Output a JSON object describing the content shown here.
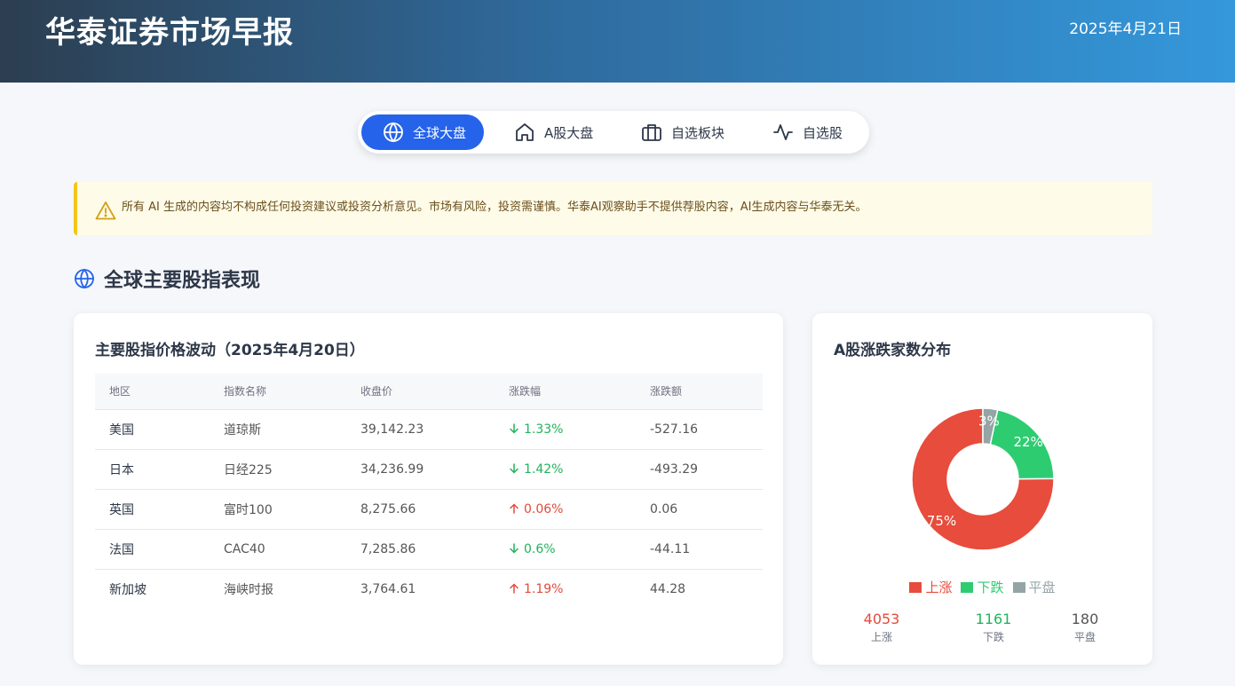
{
  "header": {
    "title": "华泰证券市场早报",
    "date": "2025年4月21日"
  },
  "tabs": [
    {
      "label": "全球大盘",
      "icon": "globe-icon",
      "active": true
    },
    {
      "label": "A股大盘",
      "icon": "home-icon",
      "active": false
    },
    {
      "label": "自选板块",
      "icon": "briefcase-icon",
      "active": false
    },
    {
      "label": "自选股",
      "icon": "activity-icon",
      "active": false
    }
  ],
  "notice": {
    "icon": "warning-icon",
    "text": "所有 AI 生成的内容均不构成任何投资建议或投资分析意见。市场有风险，投资需谨慎。华泰AI观察助手不提供荐股内容，AI生成内容与华泰无关。"
  },
  "section": {
    "title": "全球主要股指表现",
    "icon": "globe-icon"
  },
  "index_table": {
    "title": "主要股指价格波动（2025年4月20日）",
    "columns": [
      "地区",
      "指数名称",
      "收盘价",
      "涨跌幅",
      "涨跌额"
    ],
    "rows": [
      {
        "region": "美国",
        "name": "道琼斯",
        "close": "39,142.23",
        "pct": "1.33%",
        "dir": "down",
        "change": "-527.16"
      },
      {
        "region": "日本",
        "name": "日经225",
        "close": "34,236.99",
        "pct": "1.42%",
        "dir": "down",
        "change": "-493.29"
      },
      {
        "region": "英国",
        "name": "富时100",
        "close": "8,275.66",
        "pct": "0.06%",
        "dir": "up",
        "change": "0.06"
      },
      {
        "region": "法国",
        "name": "CAC40",
        "close": "7,285.86",
        "pct": "0.6%",
        "dir": "down",
        "change": "-44.11"
      },
      {
        "region": "新加坡",
        "name": "海峡时报",
        "close": "3,764.61",
        "pct": "1.19%",
        "dir": "up",
        "change": "44.28"
      }
    ]
  },
  "colors": {
    "up": "#e74c3c",
    "down": "#2ecc71",
    "flat": "#95a5a6",
    "accent": "#2563eb"
  },
  "chart_data": {
    "type": "pie",
    "title": "A股涨跌家数分布",
    "slices": [
      {
        "name": "上涨",
        "value": 4053,
        "label": "75%"
      },
      {
        "name": "下跌",
        "value": 1161,
        "label": "22%"
      },
      {
        "name": "平盘",
        "value": 180,
        "label": "3%"
      }
    ],
    "legend_position": "bottom"
  }
}
